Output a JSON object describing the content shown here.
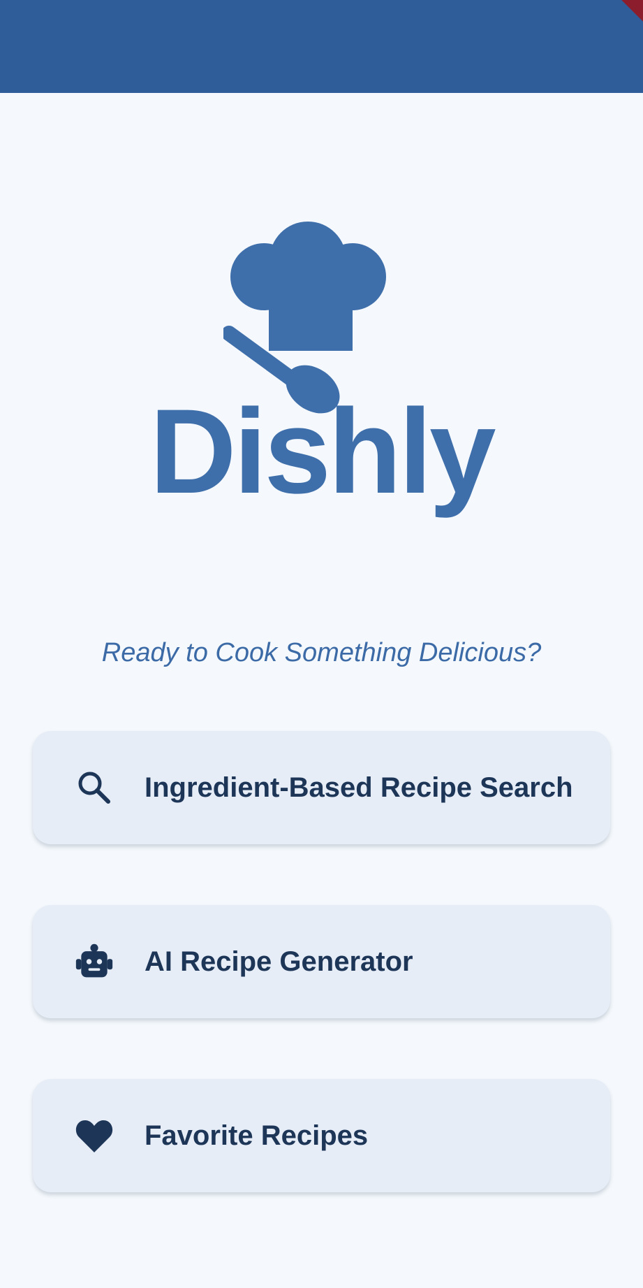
{
  "app": {
    "brand_name": "Dishly",
    "tagline": "Ready to Cook Something Delicious?"
  },
  "colors": {
    "app_bar": "#2e5d9a",
    "background": "#f5f9fd",
    "brand": "#3f6fab",
    "card_bg": "#e6edf7",
    "card_text": "#1d3557"
  },
  "menu": {
    "items": [
      {
        "label": "Ingredient-Based Recipe Search",
        "icon": "search-icon"
      },
      {
        "label": "AI Recipe Generator",
        "icon": "robot-icon"
      },
      {
        "label": "Favorite Recipes",
        "icon": "heart-icon"
      }
    ]
  }
}
